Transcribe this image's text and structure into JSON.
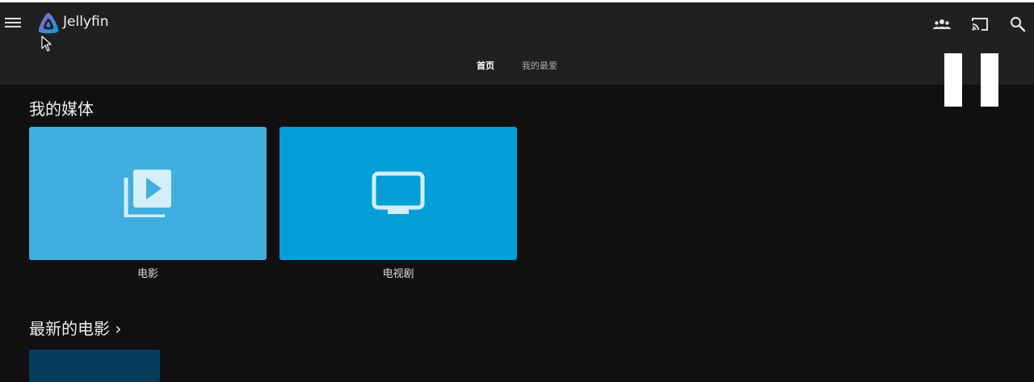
{
  "app": {
    "title": "Jellyfin"
  },
  "tabs": [
    {
      "label": "首页",
      "active": true
    },
    {
      "label": "我的最爱",
      "active": false
    }
  ],
  "header_icons": [
    "users-icon",
    "cast-icon",
    "search-icon"
  ],
  "my_media": {
    "title": "我的媒体",
    "items": [
      {
        "label": "电影",
        "icon": "video-library-icon",
        "color": "#3faedf"
      },
      {
        "label": "电视剧",
        "icon": "tv-icon",
        "color": "#049ed8"
      }
    ]
  },
  "latest_movies": {
    "title": "最新的电影",
    "chevron": "›"
  },
  "colors": {
    "accent_purple": "#aa5cc3",
    "accent_blue": "#00a4dc",
    "background": "#101010",
    "header": "#202020"
  }
}
